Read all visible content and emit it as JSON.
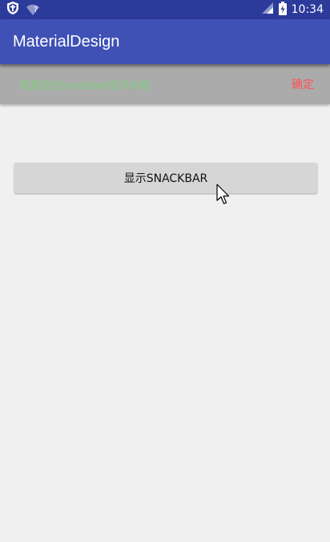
{
  "status_bar": {
    "time": "10:34",
    "icons": [
      "shield-icon",
      "wifi-unknown-icon",
      "signal-icon",
      "battery-charging-icon"
    ],
    "wifi_unknown_glyph": "?"
  },
  "app_bar": {
    "title": "MaterialDesign",
    "color": "#3f51b5"
  },
  "snackbar": {
    "message": "我是测试snackbar显示内容",
    "action_label": "确定",
    "message_color": "#7fd07f",
    "action_color": "#ff5252"
  },
  "main": {
    "show_button_label": "显示SNACKBAR"
  }
}
